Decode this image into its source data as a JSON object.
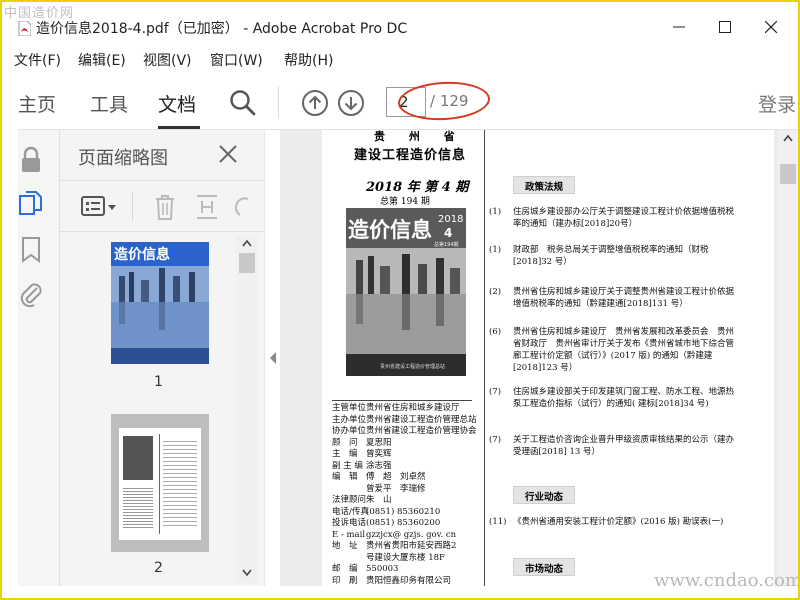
{
  "watermarks": {
    "top_left": "中国造价网",
    "bottom_right": "www.cndao.com"
  },
  "window": {
    "title": "造价信息2018-4.pdf（已加密） - Adobe Acrobat Pro DC",
    "minimize_icon": "minimize-icon",
    "maximize_icon": "maximize-icon",
    "close_icon": "close-icon"
  },
  "menu": [
    "文件(F)",
    "编辑(E)",
    "视图(V)",
    "窗口(W)",
    "帮助(H)"
  ],
  "toolbar": {
    "tabs": [
      "主页",
      "工具",
      "文档"
    ],
    "active_tab": "文档",
    "current_page": "2",
    "total_pages": "/ 129",
    "login": "登录",
    "annotation_color": "#d33a1e"
  },
  "left_panel": {
    "title": "页面缩略图",
    "thumbnails": [
      {
        "label": "1"
      },
      {
        "label": "2"
      }
    ]
  },
  "document": {
    "masthead_line1": "贵 州 省",
    "masthead_line2": "建设工程造价信息",
    "issue": "2018 年 第 4 期",
    "total_issue": "总第 194 期",
    "cover": {
      "title": "造价信息",
      "year": "2018",
      "number": "4",
      "total": "总第194期",
      "publisher": "贵州省建设工程造价管理总站"
    },
    "staff": [
      {
        "k": "主管单位",
        "v": "贵州省住房和城乡建设厅"
      },
      {
        "k": "主办单位",
        "v": "贵州省建设工程造价管理总站"
      },
      {
        "k": "协办单位",
        "v": "贵州省建设工程造价管理协会"
      },
      {
        "k": "顾　问",
        "v": "夏思阳"
      },
      {
        "k": "主　编",
        "v": "曾奕辉"
      },
      {
        "k": "副 主 编",
        "v": "涂志强"
      },
      {
        "k": "编　辑",
        "v": "傅　超　刘卓然"
      },
      {
        "k": "",
        "v": "曾爱平　李瑞修"
      },
      {
        "k": "法律顾问",
        "v": "朱　山"
      },
      {
        "k": "电话/传真",
        "v": "(0851) 85360210"
      },
      {
        "k": "投诉电话",
        "v": "(0851) 85360200"
      },
      {
        "k": "E - mail",
        "v": "gzzjcx@ gzjs. gov. cn"
      },
      {
        "k": "地　址",
        "v": "贵州省贵阳市延安西路2"
      },
      {
        "k": "",
        "v": "号建设大厦东楼 18F"
      },
      {
        "k": "邮　编",
        "v": "550003"
      },
      {
        "k": "印　刷",
        "v": "贵阳恒鑫印务有限公司"
      }
    ],
    "sections": [
      {
        "title": "政策法规",
        "entries": [
          {
            "num": "(1)",
            "text": "住房城乡建设部办公厅关于调整建设工程计价依据增值税税率的通知（建办标[2018]20号）"
          },
          {
            "num": "(1)",
            "text": "财政部　税务总局关于调整增值税税率的通知（财税[2018]32 号）"
          },
          {
            "num": "(2)",
            "text": "贵州省住房和城乡建设厅关于调整贵州省建设工程计价依据增值税税率的通知（黔建建通[2018]131 号）"
          },
          {
            "num": "(6)",
            "text": "贵州省住房和城乡建设厅　贵州省发展和改革委员会　贵州省财政厅　贵州省审计厅关于发布《贵州省城市地下综合管廊工程计价定额（试行）》(2017 版) 的通知（黔建建[2018]123 号）"
          },
          {
            "num": "(7)",
            "text": "住房城乡建设部关于印发建筑门窗工程、防水工程、地源热泵工程造价指标（试行）的通知( 建标[2018]34 号)"
          },
          {
            "num": "(7)",
            "text": "关于工程造价咨询企业晋升甲级资质审核结果的公示（建办受理函[2018] 13 号）"
          }
        ]
      },
      {
        "title": "行业动态",
        "entries": [
          {
            "num": "(11)",
            "text": "《贵州省通用安装工程计价定额》(2016 版) 勘误表(一)"
          }
        ]
      },
      {
        "title": "市场动态",
        "entries": []
      }
    ]
  }
}
